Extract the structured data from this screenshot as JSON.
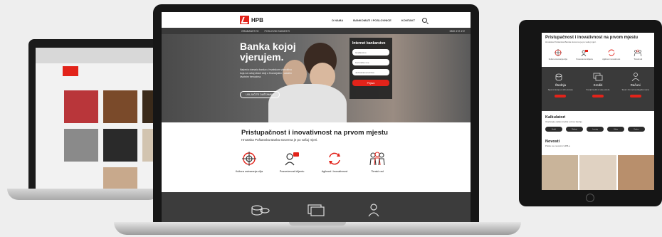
{
  "brand": {
    "logo_text": "HPB",
    "accent": "#e2231a"
  },
  "nav": {
    "items": [
      "O NAMA",
      "BANKOMATI I POSLOVNICE",
      "KONTAKT"
    ],
    "search_icon": "search-icon"
  },
  "sub_nav": {
    "items": [
      "GRAĐANSTVO",
      "POSLOVNI SUBJEKTI"
    ],
    "phone": "0800 472 472"
  },
  "hero": {
    "title": "Banka kojoj vjerujem.",
    "text": "Najveća domaća banka u hrvatskom vlasništvu koja na vašoj strani stoji u financijskim i ostalim životnim trenucima.",
    "button": "UKLJUČITE DAŠTAMNU"
  },
  "login": {
    "title": "Internet bankarstvo",
    "select": "Građanstvo",
    "username_placeholder": "Korisničko ime",
    "password_placeholder": "Jednokratna lozinka",
    "submit": "Prijava"
  },
  "intro": {
    "title": "Pristupačnost i inovativnost na prvom mjestu",
    "subtitle": "Hrvatska Poštanska Banka stvorena je po vašoj mjeri."
  },
  "features": [
    {
      "icon": "target-icon",
      "label": "Kultura ostvarenja cilja"
    },
    {
      "icon": "handshake-icon",
      "label": "Posvećenost klijentu"
    },
    {
      "icon": "refresh-icon",
      "label": "Agilnost i inovativnost"
    },
    {
      "icon": "team-icon",
      "label": "Timski rad"
    }
  ],
  "tablet": {
    "title": "Pristupačnost i inovativnost na prvom mjestu",
    "subtitle": "Hrvatska Poštanska Banka stvorena je po vašoj mjeri.",
    "icon_labels": [
      "Kultura ostvarenja cilja",
      "Posvećenost klijentu",
      "Agilnost i inovativnost",
      "Timski rad"
    ],
    "products": [
      {
        "label": "Štednja",
        "text": "Sigurno štednja uz dobre kamate"
      },
      {
        "label": "Krediti",
        "text": "Povoljni krediti za vaše potrebe"
      },
      {
        "label": "Računi",
        "text": "Tekući i žiro računi prilagođeni vama"
      }
    ],
    "calc_title": "Kalkulatori",
    "calc_subtitle": "Izračunajte otplatu kredita i prinos štednje.",
    "calc_pills": [
      "Kredit",
      "Štednja",
      "Leasing",
      "Valuta",
      "Kartice"
    ],
    "news_title": "Novosti",
    "news_subtitle": "Pratite sve novosti iz HPB-a"
  }
}
